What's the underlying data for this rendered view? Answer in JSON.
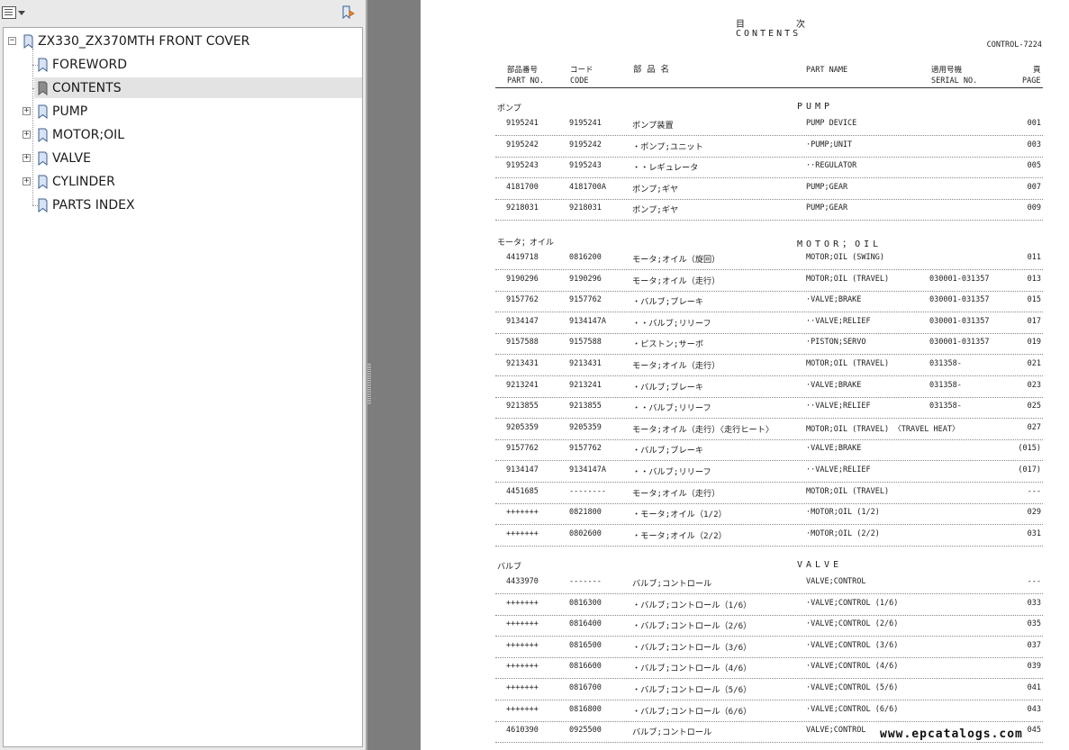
{
  "bookmarks": {
    "items": [
      {
        "label": "ZX330_ZX370MTH FRONT COVER",
        "expander": "−"
      },
      {
        "label": "FOREWORD"
      },
      {
        "label": "CONTENTS",
        "selected": true
      },
      {
        "label": "PUMP",
        "expander": "+"
      },
      {
        "label": "MOTOR;OIL",
        "expander": "+"
      },
      {
        "label": "VALVE",
        "expander": "+"
      },
      {
        "label": "CYLINDER",
        "expander": "+"
      },
      {
        "label": "PARTS INDEX"
      }
    ]
  },
  "document": {
    "title_jp_1": "目",
    "title_jp_2": "次",
    "title_en": "CONTENTS",
    "doc_code": "CONTROL-7224",
    "headers": {
      "part_jp": "部品番号",
      "part_en": "PART NO.",
      "code_jp": "コード",
      "code_en": "CODE",
      "name_jp": "部 品 名",
      "name_en": "PART NAME",
      "serial_jp": "適用号機",
      "serial_en": "SERIAL NO.",
      "page_jp": "頁",
      "page_en": "PAGE"
    },
    "sections": [
      {
        "jp": "ポンプ",
        "en": "PUMP",
        "rows": [
          {
            "part": "9195241",
            "code": "9195241",
            "jp": "ポンプ装置",
            "en": "PUMP DEVICE",
            "serial": "",
            "page": "001"
          },
          {
            "part": "9195242",
            "code": "9195242",
            "jp": "・ポンプ;ユニット",
            "en": "·PUMP;UNIT",
            "serial": "",
            "page": "003"
          },
          {
            "part": "9195243",
            "code": "9195243",
            "jp": "・・レギュレータ",
            "en": "··REGULATOR",
            "serial": "",
            "page": "005"
          },
          {
            "part": "4181700",
            "code": "4181700A",
            "jp": "ポンプ;ギヤ",
            "en": "PUMP;GEAR",
            "serial": "",
            "page": "007"
          },
          {
            "part": "9218031",
            "code": "9218031",
            "jp": "ポンプ;ギヤ",
            "en": "PUMP;GEAR",
            "serial": "",
            "page": "009"
          }
        ]
      },
      {
        "jp": "モータ；オイル",
        "en": "MOTOR；OIL",
        "rows": [
          {
            "part": "4419718",
            "code": "0816200",
            "jp": "モータ;オイル（旋回）",
            "en": "MOTOR;OIL (SWING)",
            "serial": "",
            "page": "011"
          },
          {
            "part": "9190296",
            "code": "9190296",
            "jp": "モータ;オイル（走行）",
            "en": "MOTOR;OIL (TRAVEL)",
            "serial": "030001-031357",
            "page": "013"
          },
          {
            "part": "9157762",
            "code": "9157762",
            "jp": "・バルブ;ブレーキ",
            "en": "·VALVE;BRAKE",
            "serial": "030001-031357",
            "page": "015"
          },
          {
            "part": "9134147",
            "code": "9134147A",
            "jp": "・・バルブ;リリーフ",
            "en": "··VALVE;RELIEF",
            "serial": "030001-031357",
            "page": "017"
          },
          {
            "part": "9157588",
            "code": "9157588",
            "jp": "・ピストン;サーボ",
            "en": "·PISTON;SERVO",
            "serial": "030001-031357",
            "page": "019"
          },
          {
            "part": "9213431",
            "code": "9213431",
            "jp": "モータ;オイル（走行）",
            "en": "MOTOR;OIL (TRAVEL)",
            "serial": "031358-",
            "page": "021"
          },
          {
            "part": "9213241",
            "code": "9213241",
            "jp": "・バルブ;ブレーキ",
            "en": "·VALVE;BRAKE",
            "serial": "031358-",
            "page": "023"
          },
          {
            "part": "9213855",
            "code": "9213855",
            "jp": "・・バルブ;リリーフ",
            "en": "··VALVE;RELIEF",
            "serial": "031358-",
            "page": "025"
          },
          {
            "part": "9205359",
            "code": "9205359",
            "jp": "モータ;オイル（走行）〈走行ヒート〉",
            "en": "MOTOR;OIL (TRAVEL) 〈TRAVEL HEAT〉",
            "serial": "",
            "page": "027"
          },
          {
            "part": "9157762",
            "code": "9157762",
            "jp": "・バルブ;ブレーキ",
            "en": "·VALVE;BRAKE",
            "serial": "",
            "page": "(015)"
          },
          {
            "part": "9134147",
            "code": "9134147A",
            "jp": "・・バルブ;リリーフ",
            "en": "··VALVE;RELIEF",
            "serial": "",
            "page": "(017)"
          },
          {
            "part": "4451685",
            "code": "--------",
            "jp": "モータ;オイル（走行）",
            "en": "MOTOR;OIL  (TRAVEL)",
            "serial": "",
            "page": "---"
          },
          {
            "part": "+++++++",
            "code": "0821800",
            "jp": "・モータ;オイル（1/2）",
            "en": "·MOTOR;OIL (1/2)",
            "serial": "",
            "page": "029"
          },
          {
            "part": "+++++++",
            "code": "0802600",
            "jp": "・モータ;オイル（2/2）",
            "en": "·MOTOR;OIL (2/2)",
            "serial": "",
            "page": "031"
          }
        ]
      },
      {
        "jp": "バルブ",
        "en": "VALVE",
        "rows": [
          {
            "part": "4433970",
            "code": "-------",
            "jp": "バルブ;コントロール",
            "en": "VALVE;CONTROL",
            "serial": "",
            "page": "---"
          },
          {
            "part": "+++++++",
            "code": "0816300",
            "jp": "・バルブ;コントロール（1/6）",
            "en": "·VALVE;CONTROL (1/6)",
            "serial": "",
            "page": "033"
          },
          {
            "part": "+++++++",
            "code": "0816400",
            "jp": "・バルブ;コントロール（2/6）",
            "en": "·VALVE;CONTROL (2/6)",
            "serial": "",
            "page": "035"
          },
          {
            "part": "+++++++",
            "code": "0816500",
            "jp": "・バルブ;コントロール（3/6）",
            "en": "·VALVE;CONTROL (3/6)",
            "serial": "",
            "page": "037"
          },
          {
            "part": "+++++++",
            "code": "0816600",
            "jp": "・バルブ;コントロール（4/6）",
            "en": "·VALVE;CONTROL (4/6)",
            "serial": "",
            "page": "039"
          },
          {
            "part": "+++++++",
            "code": "0816700",
            "jp": "・バルブ;コントロール（5/6）",
            "en": "·VALVE;CONTROL (5/6)",
            "serial": "",
            "page": "041"
          },
          {
            "part": "+++++++",
            "code": "0816800",
            "jp": "・バルブ;コントロール（6/6）",
            "en": "·VALVE;CONTROL (6/6)",
            "serial": "",
            "page": "043"
          },
          {
            "part": "4610390",
            "code": "0925500",
            "jp": "バルブ;コントロール",
            "en": "VALVE;CONTROL",
            "serial": "",
            "page": "045"
          }
        ]
      }
    ],
    "watermark": "www.epcatalogs.com"
  },
  "colors": {
    "panel_bg": "#e9e9e9",
    "viewer_bg": "#7d7d7d",
    "selected_bg": "#e3e3e3"
  }
}
